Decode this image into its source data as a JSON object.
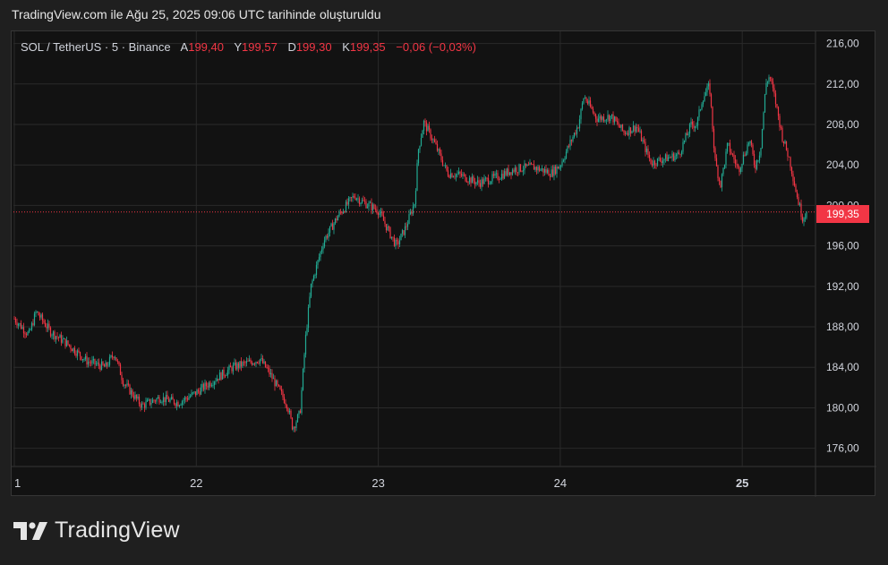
{
  "caption": "TradingView.com ile Ağu 25, 2025 09:06 UTC tarihinde oluşturuldu",
  "header": {
    "symbol": "SOL / TetherUS · 5 · Binance",
    "open_label": "A",
    "open": "199,40",
    "high_label": "Y",
    "high": "199,57",
    "low_label": "D",
    "low": "199,30",
    "close_label": "K",
    "close": "199,35",
    "change": "−0,06 (−0,03%)"
  },
  "last_price_label": "199,35",
  "brand": {
    "name": "TradingView",
    "logo_icon": "tradingview-logo-icon"
  },
  "colors": {
    "up": "#22ab94",
    "down": "#f23645",
    "background": "#121212",
    "grid": "#2a2a2a"
  },
  "chart_data": {
    "type": "candlestick",
    "y_ticks": [
      "176,00",
      "180,00",
      "184,00",
      "188,00",
      "192,00",
      "196,00",
      "200,00",
      "204,00",
      "208,00",
      "212,00",
      "216,00"
    ],
    "y_tick_values": [
      176,
      180,
      184,
      188,
      192,
      196,
      200,
      204,
      208,
      212,
      216
    ],
    "ylim": [
      174.2,
      217.2
    ],
    "x_ticks": [
      "1",
      "22",
      "23",
      "24",
      "25"
    ],
    "x_tick_days": [
      0,
      1,
      2,
      3,
      4
    ],
    "bold_x_tick": "25",
    "xlim": [
      0,
      4.36
    ],
    "last_price": 199.35,
    "price_path": [
      [
        0.0,
        188.8
      ],
      [
        0.08,
        187.2
      ],
      [
        0.12,
        189.5
      ],
      [
        0.2,
        187.5
      ],
      [
        0.3,
        186.2
      ],
      [
        0.4,
        184.6
      ],
      [
        0.5,
        184.0
      ],
      [
        0.55,
        185.4
      ],
      [
        0.6,
        182.5
      ],
      [
        0.7,
        180.2
      ],
      [
        0.8,
        181.0
      ],
      [
        0.9,
        180.5
      ],
      [
        1.0,
        181.5
      ],
      [
        1.1,
        182.8
      ],
      [
        1.2,
        184.0
      ],
      [
        1.35,
        184.8
      ],
      [
        1.4,
        183.5
      ],
      [
        1.5,
        180.3
      ],
      [
        1.53,
        178.0
      ],
      [
        1.57,
        179.5
      ],
      [
        1.6,
        186.8
      ],
      [
        1.63,
        192.0
      ],
      [
        1.7,
        196.5
      ],
      [
        1.78,
        199.0
      ],
      [
        1.87,
        201.0
      ],
      [
        1.9,
        200.5
      ],
      [
        2.0,
        199.5
      ],
      [
        2.07,
        197.0
      ],
      [
        2.1,
        196.0
      ],
      [
        2.15,
        197.8
      ],
      [
        2.2,
        200.3
      ],
      [
        2.22,
        205.5
      ],
      [
        2.25,
        208.2
      ],
      [
        2.3,
        206.5
      ],
      [
        2.38,
        203.2
      ],
      [
        2.45,
        203.0
      ],
      [
        2.55,
        202.2
      ],
      [
        2.65,
        202.8
      ],
      [
        2.75,
        203.6
      ],
      [
        2.85,
        203.8
      ],
      [
        2.95,
        203.2
      ],
      [
        3.0,
        204.0
      ],
      [
        3.05,
        206.0
      ],
      [
        3.1,
        208.0
      ],
      [
        3.13,
        210.8
      ],
      [
        3.2,
        208.6
      ],
      [
        3.28,
        208.8
      ],
      [
        3.35,
        207.2
      ],
      [
        3.42,
        207.8
      ],
      [
        3.47,
        205.5
      ],
      [
        3.5,
        204.2
      ],
      [
        3.55,
        204.5
      ],
      [
        3.65,
        205.0
      ],
      [
        3.72,
        208.0
      ],
      [
        3.75,
        208.0
      ],
      [
        3.78,
        210.5
      ],
      [
        3.82,
        211.8
      ],
      [
        3.85,
        204.5
      ],
      [
        3.88,
        202.0
      ],
      [
        3.92,
        206.0
      ],
      [
        3.98,
        203.5
      ],
      [
        4.04,
        206.5
      ],
      [
        4.07,
        203.8
      ],
      [
        4.1,
        205.5
      ],
      [
        4.13,
        212.0
      ],
      [
        4.15,
        212.8
      ],
      [
        4.18,
        210.5
      ],
      [
        4.22,
        206.8
      ],
      [
        4.26,
        204.5
      ],
      [
        4.3,
        201.0
      ],
      [
        4.33,
        198.8
      ],
      [
        4.36,
        199.35
      ]
    ]
  }
}
